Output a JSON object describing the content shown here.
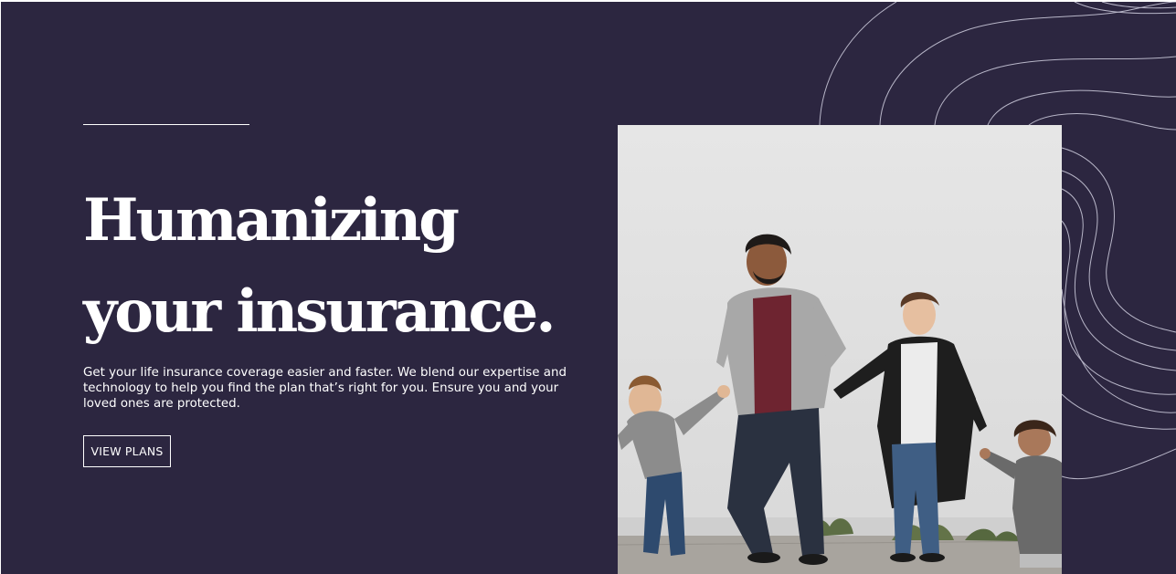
{
  "hero": {
    "headline_line1": "Humanizing",
    "headline_line2": "your insurance.",
    "description": "Get your life insurance coverage easier and faster. We blend our expertise and technology to help you find the plan that’s right for you. Ensure you and your loved ones are protected.",
    "cta_label": "VIEW PLANS",
    "image_alt": "Family of four holding hands and walking along a white wall"
  },
  "colors": {
    "background": "#2c2640",
    "text": "#ffffff",
    "contour_lines": "#b8b6c8"
  },
  "icons": {
    "background_decoration": "topographic-contour-lines"
  }
}
